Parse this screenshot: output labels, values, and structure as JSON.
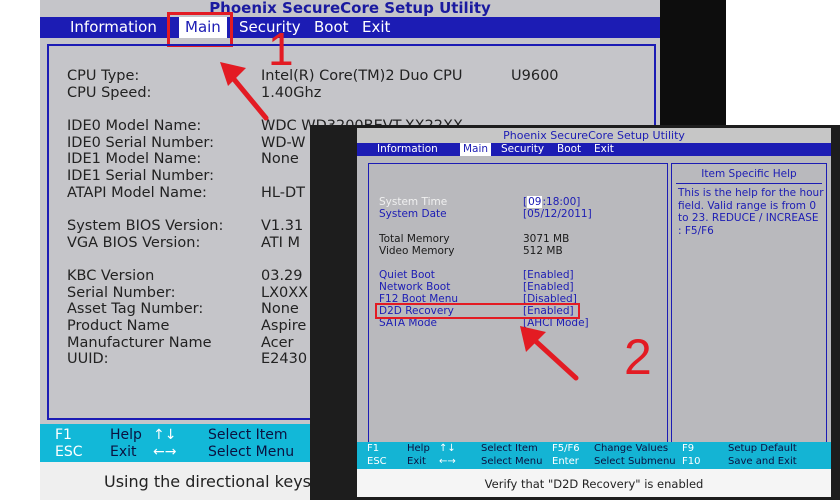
{
  "back_screen": {
    "title": "Phoenix SecureCore Setup Utility",
    "tabs": [
      "Information",
      "Main",
      "Security",
      "Boot",
      "Exit"
    ],
    "rows": [
      {
        "label": "CPU Type:",
        "value": "Intel(R) Core(TM)2 Duo CPU",
        "value2": "U9600"
      },
      {
        "label": "CPU Speed:",
        "value": "1.40Ghz"
      },
      {
        "label": "IDE0 Model Name:",
        "value": "WDC WD3200BEVT-XX22XX"
      },
      {
        "label": "IDE0 Serial Number:",
        "value": "WD-W"
      },
      {
        "label": "IDE1 Model Name:",
        "value": "None"
      },
      {
        "label": "IDE1 Serial Number:",
        "value": ""
      },
      {
        "label": "ATAPI  Model Name:",
        "value": "HL-DT"
      },
      {
        "label": "System BIOS Version:",
        "value": "V1.31"
      },
      {
        "label": "VGA BIOS Version:",
        "value": "ATI M"
      },
      {
        "label": "KBC Version",
        "value": "03.29"
      },
      {
        "label": "Serial Number:",
        "value": "LX0XX"
      },
      {
        "label": "Asset Tag Number:",
        "value": "None"
      },
      {
        "label": "Product Name",
        "value": "Aspire"
      },
      {
        "label": "Manufacturer Name",
        "value": "Acer"
      },
      {
        "label": "UUID:",
        "value": "E2430"
      }
    ],
    "footer": {
      "f1": "F1",
      "help": "Help",
      "updown": "↑↓",
      "select_item": "Select Item",
      "esc": "ESC",
      "exit": "Exit",
      "leftright": "←→",
      "select_menu": "Select Menu"
    },
    "bottom_text": "Using the directional keys Rig"
  },
  "front_screen": {
    "title": "Phoenix SecureCore Setup Utility",
    "tabs": [
      "Information",
      "Main",
      "Security",
      "Boot",
      "Exit"
    ],
    "items": {
      "system_time_label": "System Time",
      "system_time_cursor": "09",
      "system_time_rest": ":18:00]",
      "system_date_label": "System Date",
      "system_date_value": "[05/12/2011]",
      "total_memory_label": "Total   Memory",
      "total_memory_value": "3071 MB",
      "video_memory_label": "Video   Memory",
      "video_memory_value": "512 MB",
      "quiet_boot_label": "Quiet Boot",
      "quiet_boot_value": "[Enabled]",
      "network_boot_label": "Network Boot",
      "network_boot_value": "[Enabled]",
      "f12_boot_label": "F12 Boot Menu",
      "f12_boot_value": "[Disabled]",
      "d2d_label": "D2D Recovery",
      "d2d_value": "[Enabled]",
      "sata_label": "SATA Mode",
      "sata_value": "[AHCI Mode]"
    },
    "help_panel": {
      "title": "Item Specific Help",
      "text": "This is the help for the hour field. Valid range is from 0 to 23. REDUCE / INCREASE : F5/F6"
    },
    "footer": {
      "f1": "F1",
      "help": "Help",
      "updown": "↑↓",
      "select_item": "Select Item",
      "f5f6": "F5/F6",
      "change_values": "Change Values",
      "f9": "F9",
      "setup_default": "Setup Default",
      "esc": "ESC",
      "exit": "Exit",
      "leftright": "←→",
      "select_menu": "Select Menu",
      "enter": "Enter",
      "select_submenu": "Select Submenu",
      "f10": "F10",
      "save_exit": "Save and Exit"
    },
    "bottom_text": "Verify that \"D2D Recovery\" is enabled"
  },
  "annotations": {
    "step1": "1",
    "step2": "2"
  },
  "colors": {
    "bios_blue": "#1c1cb4",
    "footer_cyan": "#14b4d4",
    "highlight_red": "#e31b23",
    "bios_gray": "#c5c5c9"
  }
}
